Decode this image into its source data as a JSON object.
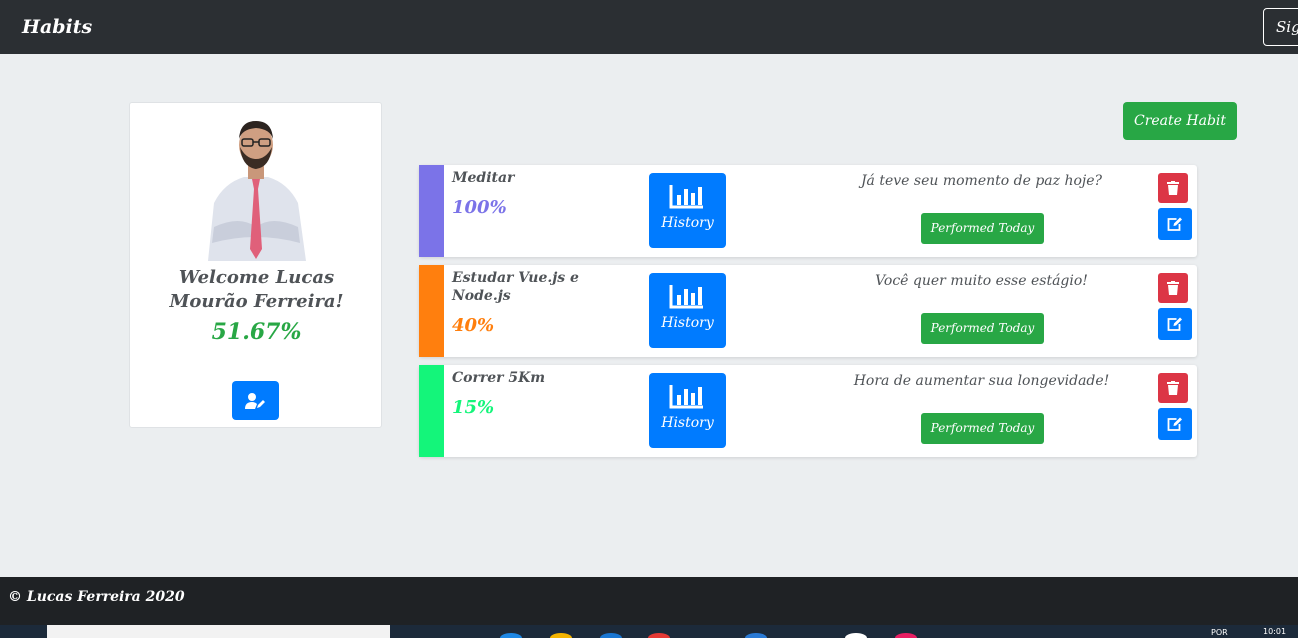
{
  "navbar": {
    "brand": "Habits",
    "signout_label": "Sig"
  },
  "profile": {
    "welcome": "Welcome Lucas Mourão Ferreira!",
    "overall_percentage": "51.67%",
    "edit_icon": "user-edit-icon"
  },
  "create_habit_label": "Create Habit",
  "habits": [
    {
      "name": "Meditar",
      "percentage": "100%",
      "color": "#7b73e8",
      "history_label": "History",
      "motivation": "Já teve seu momento de paz hoje?",
      "performed_label": "Performed Today"
    },
    {
      "name": "Estudar Vue.js e Node.js",
      "percentage": "40%",
      "color": "#ff7f0e",
      "history_label": "History",
      "motivation": "Você quer muito esse estágio!",
      "performed_label": "Performed Today"
    },
    {
      "name": "Correr 5Km",
      "percentage": "15%",
      "color": "#14f57a",
      "history_label": "History",
      "motivation": "Hora de aumentar sua longevidade!",
      "performed_label": "Performed Today"
    }
  ],
  "footer": {
    "text": "© Lucas Ferreira 2020"
  },
  "taskbar": {
    "language": "POR",
    "time": "10:01"
  },
  "colors": {
    "primary": "#007bff",
    "success": "#28a745",
    "danger": "#dc3545",
    "navbar": "#2b2f33",
    "footer": "#1f2225"
  }
}
